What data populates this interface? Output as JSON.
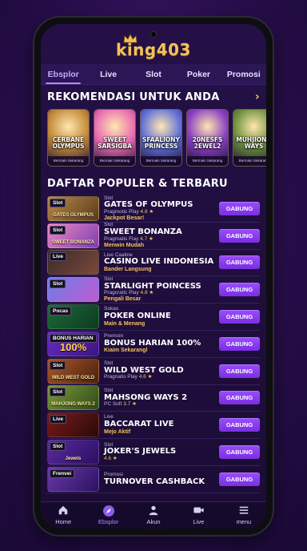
{
  "app": {
    "logo": "king403"
  },
  "tabs": [
    {
      "label": "Ebsplor",
      "active": true
    },
    {
      "label": "Live",
      "active": false
    },
    {
      "label": "Slot",
      "active": false
    },
    {
      "label": "Poker",
      "active": false
    },
    {
      "label": "Promosi",
      "active": false
    }
  ],
  "recommended": {
    "title": "REKOMENDASI UNTUK ANDA",
    "cards": [
      {
        "name": "CERBANE OLYMPUS",
        "footer": "Bermain Sekarang",
        "color": "#c48a3a"
      },
      {
        "name": "SWEET SARSIGBA",
        "footer": "Bermain Sekarang",
        "color": "#e96db0"
      },
      {
        "name": "SFAALIONY PRINCESS",
        "footer": "Bermain Sekarang",
        "color": "#5e6fd8"
      },
      {
        "name": "20NESFS 2EWEL2",
        "footer": "Bermain Sekarang",
        "color": "#8a3fc2"
      },
      {
        "name": "MUHJIONG WAYS",
        "footer": "Bermain Sekarang",
        "color": "#6a8f3a"
      }
    ]
  },
  "popular": {
    "title": "DAFTAR POPULER & TERBARU",
    "rows": [
      {
        "tag": "Slot",
        "thumb_title": "GATES OLYMPUS",
        "category": "Slot",
        "name": "GATES OF OLYMPUS",
        "meta": "Pragmotic Play",
        "rating": "4.8",
        "subtitle": "Jackpot Besar!",
        "button": "GABUNG",
        "color1": "#b88a4a",
        "color2": "#5a3a1c"
      },
      {
        "tag": "Slot",
        "thumb_title": "SWEET BONANZA",
        "category": "Slot",
        "name": "SWEET BONANZA",
        "meta": "Pragmatis Flay",
        "rating": "4.7",
        "subtitle": "Menwin Mudah",
        "button": "GABUNG",
        "color1": "#f087c3",
        "color2": "#7b3fb0"
      },
      {
        "tag": "Live",
        "thumb_title": "",
        "category": "Live Caaline",
        "name": "CASINO LIVE INDONESIA",
        "meta": "",
        "rating": "",
        "subtitle": "Bander Langsung",
        "button": "GABUNG",
        "color1": "#3a2a2a",
        "color2": "#7a4a3a"
      },
      {
        "tag": "Slot",
        "thumb_title": "",
        "category": "Slot",
        "name": "STARLIGHT POINCESS",
        "meta": "Pragcratic Play",
        "rating": "4.8",
        "subtitle": "Pengali Besar",
        "button": "GABUNG",
        "color1": "#6a7fe8",
        "color2": "#c05ad0"
      },
      {
        "tag": "Pocas",
        "thumb_title": "",
        "category": "Sokas",
        "name": "POKER ONLINE",
        "meta": "",
        "rating": "",
        "subtitle": "Main & Menang",
        "button": "GABUNG",
        "color1": "#1d6a3a",
        "color2": "#0e3a20"
      },
      {
        "tag": "BONUS HARIAN",
        "thumb_title": "100%",
        "category": "Premoin",
        "name": "BONUS HARIAN 100%",
        "meta": "",
        "rating": "",
        "subtitle": "Kiaim Sekarangl",
        "button": "GABUNG",
        "color1": "#6a2bc4",
        "color2": "#3a1580"
      },
      {
        "tag": "Slot",
        "thumb_title": "WILD WEST GOLD",
        "category": "Slot",
        "name": "WILD WEST GOLD",
        "meta": "Pragnatis Play",
        "rating": "4.6",
        "subtitle": "",
        "button": "GABUNG",
        "color1": "#a8562a",
        "color2": "#4a220e"
      },
      {
        "tag": "Slot",
        "thumb_title": "MAHJONG WAYS 2",
        "category": "Slot",
        "name": "MAHSONG WAYS 2",
        "meta": "PC Soft",
        "rating": "3.7",
        "subtitle": "",
        "button": "GABUNG",
        "color1": "#7a9a3a",
        "color2": "#2e4a18"
      },
      {
        "tag": "Live",
        "thumb_title": "",
        "category": "Live",
        "name": "BACCARAT LIVE",
        "meta": "",
        "rating": "",
        "subtitle": "Mejo Aktif",
        "button": "GABUNG",
        "color1": "#7a1a1a",
        "color2": "#2a0a0a"
      },
      {
        "tag": "Slot",
        "thumb_title": "Jewels",
        "category": "Slot",
        "name": "JOKER'S JEWELS",
        "meta": "",
        "rating": "4.6",
        "subtitle": "",
        "button": "GABUNG",
        "color1": "#5a2aa0",
        "color2": "#2a1060"
      },
      {
        "tag": "Frenvei",
        "thumb_title": "",
        "category": "Promosi",
        "name": "TURNOVER CASHBACK",
        "meta": "",
        "rating": "",
        "subtitle": "",
        "button": "GABUNG",
        "color1": "#6a3aaa",
        "color2": "#2a1260"
      }
    ]
  },
  "bottom_nav": [
    {
      "label": "Home",
      "icon": "home-icon",
      "active": false
    },
    {
      "label": "Ebsplor",
      "icon": "explore-icon",
      "active": true
    },
    {
      "label": "Akun",
      "icon": "user-icon",
      "active": false
    },
    {
      "label": "Live",
      "icon": "video-icon",
      "active": false
    },
    {
      "label": "menu",
      "icon": "menu-icon",
      "active": false
    }
  ],
  "colors": {
    "accent": "#9b4dff",
    "gold": "#f2c25a",
    "background": "#241046"
  }
}
